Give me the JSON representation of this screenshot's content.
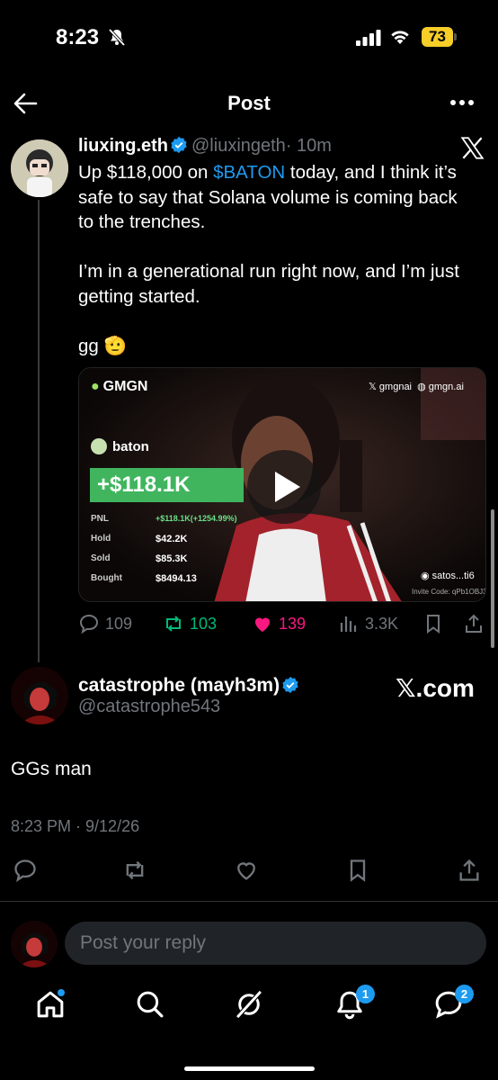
{
  "status_bar": {
    "time": "8:23",
    "battery": "73"
  },
  "header": {
    "title": "Post"
  },
  "tweet": {
    "author_name": "liuxing.eth",
    "handle": "@liuxingeth",
    "age": "· 10m",
    "lines": [
      {
        "pre": "Up $118,000 on ",
        "mention": "$BATON",
        "post": " today, and I think it’s"
      },
      "safe to say that Solana volume is coming back",
      "to the trenches.",
      "",
      "I’m in a generational run right now, and I’m just",
      "getting started.",
      "",
      "gg 🫡"
    ],
    "media": {
      "brand": "GMGN",
      "social_x": "gmgnai",
      "social_web": "gmgn.ai",
      "token": "baton",
      "pnl_big": "+$118.1K",
      "stats": [
        {
          "label": "PNL",
          "value": "+$118.1K(+1254.99%)"
        },
        {
          "label": "Hold",
          "value": "$42.2K"
        },
        {
          "label": "Sold",
          "value": "$85.3K"
        },
        {
          "label": "Bought",
          "value": "$8494.13"
        }
      ],
      "user_tag": "satos...ti6",
      "invite_code": "Invite Code: qPb1OBJ3"
    },
    "counts": {
      "replies": "109",
      "reposts": "103",
      "likes": "139",
      "views": "3.3K"
    }
  },
  "reply": {
    "author_name": "catastrophe (mayh3m)",
    "handle": "@catastrophe543",
    "badge_text": "𝕏.com",
    "text": "GGs man",
    "timestamp": "8:23 PM · 9/12/26"
  },
  "compose": {
    "placeholder": "Post your reply"
  },
  "nav": {
    "notifications_badge": "1",
    "messages_badge": "2"
  },
  "colors": {
    "accent": "#1d9bf0",
    "repost": "#00ba7c",
    "like": "#f91880",
    "muted": "#71767b",
    "battery": "#f7cd28"
  }
}
